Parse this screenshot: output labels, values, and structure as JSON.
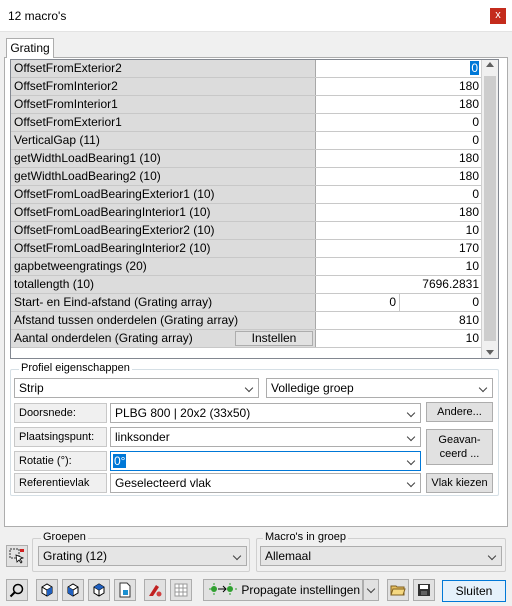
{
  "window": {
    "title": "12 macro's",
    "close_glyph": "x"
  },
  "tab": {
    "label": "Grating"
  },
  "grid": {
    "rows": [
      {
        "name": "OffsetFromExterior2",
        "value": "0"
      },
      {
        "name": "OffsetFromInterior2",
        "value": "180"
      },
      {
        "name": "OffsetFromInterior1",
        "value": "180"
      },
      {
        "name": "OffsetFromExterior1",
        "value": "0"
      },
      {
        "name": "VerticalGap (11)",
        "value": "0"
      },
      {
        "name": "getWidthLoadBearing1 (10)",
        "value": "180"
      },
      {
        "name": "getWidthLoadBearing2 (10)",
        "value": "180"
      },
      {
        "name": "OffsetFromLoadBearingExterior1 (10)",
        "value": "0"
      },
      {
        "name": "OffsetFromLoadBearingInterior1 (10)",
        "value": "180"
      },
      {
        "name": "OffsetFromLoadBearingExterior2 (10)",
        "value": "10"
      },
      {
        "name": "OffsetFromLoadBearingInterior2 (10)",
        "value": "170"
      },
      {
        "name": "gapbetweengratings (20)",
        "value": "10"
      },
      {
        "name": "totallength (10)",
        "value": "7696.2831"
      },
      {
        "name": "Start- en Eind-afstand (Grating array)",
        "value_a": "0",
        "value_b": "0"
      },
      {
        "name": "Afstand tussen onderdelen (Grating array)",
        "value": "810"
      },
      {
        "name": "Aantal onderdelen (Grating array)",
        "value": "10",
        "button": "Instellen"
      }
    ]
  },
  "profiel": {
    "legend": "Profiel eigenschappen",
    "type_select": "Strip",
    "group_select": "Volledige groep",
    "doorsnede_label": "Doorsnede:",
    "doorsnede_value": "PLBG 800 | 20x2 (33x50)",
    "andere_button": "Andere...",
    "plaatsing_label": "Plaatsingspunt:",
    "plaatsing_value": "linksonder",
    "geavanceerd_button_1": "Geavan-",
    "geavanceerd_button_2": "ceerd ...",
    "rotatie_label": "Rotatie (°):",
    "rotatie_value": "0°",
    "referentie_label": "Referentievlak",
    "referentie_value": "Geselecteerd vlak",
    "vlak_button": "Vlak kiezen"
  },
  "groepen": {
    "legend": "Groepen",
    "value": "Grating (12)"
  },
  "macros_in_groep": {
    "legend": "Macro's in groep",
    "value": "Allemaal"
  },
  "toolbar": {
    "propagate_label": "Propagate instellingen",
    "close_label": "Sluiten"
  },
  "colors": {
    "accent": "#0078d7",
    "close": "#c42b1c"
  }
}
